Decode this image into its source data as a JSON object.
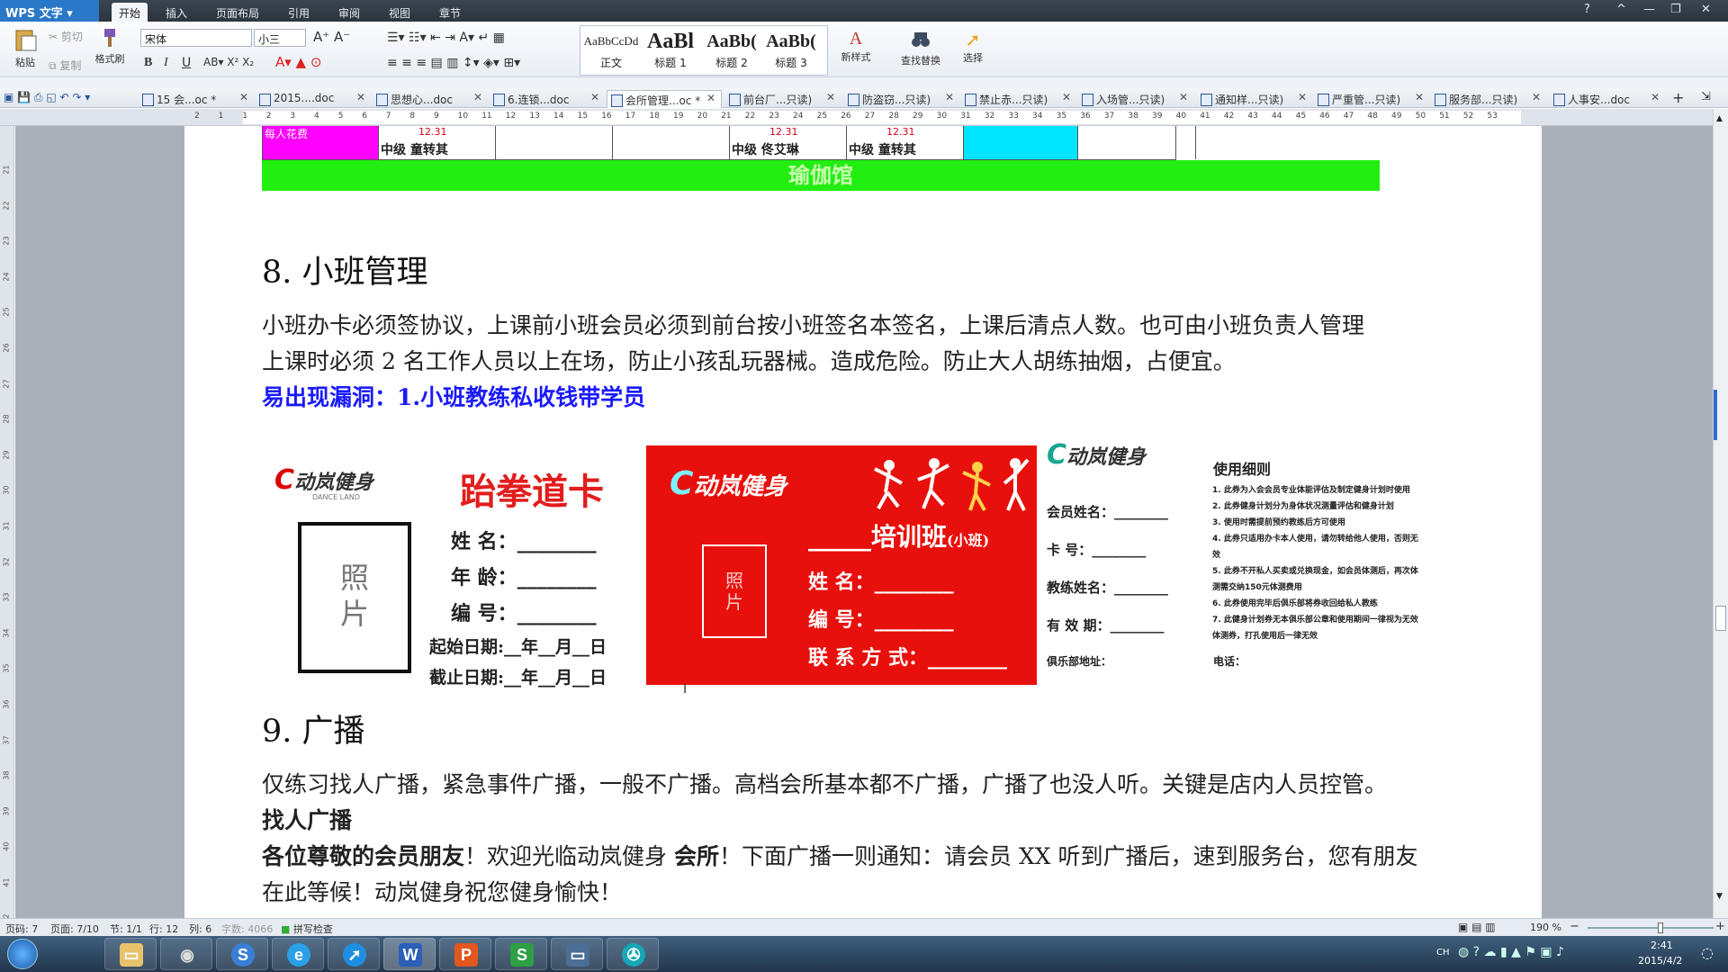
{
  "app": {
    "name": "WPS 文字"
  },
  "menu": {
    "tabs": [
      "开始",
      "插入",
      "页面布局",
      "引用",
      "审阅",
      "视图",
      "章节"
    ],
    "active": "开始"
  },
  "window_controls": [
    "?",
    "^",
    "—",
    "❐",
    "✕"
  ],
  "ribbon": {
    "paste": "粘贴",
    "cut": "剪切",
    "copy": "复制",
    "format_painter": "格式刷",
    "font_name": "宋体",
    "font_size": "小三",
    "styles": [
      {
        "preview": "AaBbCcDd",
        "label": "正文"
      },
      {
        "preview": "AaBl",
        "label": "标题 1"
      },
      {
        "preview": "AaBb(",
        "label": "标题 2"
      },
      {
        "preview": "AaBb(",
        "label": "标题 3"
      }
    ],
    "new_style": "新样式",
    "find_replace": "查找替换",
    "select": "选择"
  },
  "doc_tabs": [
    {
      "label": "15 会...oc *"
    },
    {
      "label": "2015....doc"
    },
    {
      "label": "思想心...doc"
    },
    {
      "label": "6.连锁...doc"
    },
    {
      "label": "会所管理...oc *",
      "active": true
    },
    {
      "label": "前台厂...只读)"
    },
    {
      "label": "防盗窃...只读)"
    },
    {
      "label": "禁止赤...只读)"
    },
    {
      "label": "入场管...只读)"
    },
    {
      "label": "通知样...只读)"
    },
    {
      "label": "严重管...只读)"
    },
    {
      "label": "服务部...只读)"
    },
    {
      "label": "人事安...doc"
    }
  ],
  "ruler": {
    "h_numbers": [
      "2",
      "1",
      "1",
      "2",
      "3",
      "4",
      "5",
      "6",
      "7",
      "8",
      "9",
      "10",
      "11",
      "12",
      "13",
      "14",
      "15",
      "16",
      "17",
      "18",
      "19",
      "20",
      "21",
      "22",
      "23",
      "24",
      "25",
      "26",
      "27",
      "28",
      "29",
      "30",
      "31",
      "32",
      "33",
      "34",
      "35",
      "36",
      "37",
      "38",
      "39",
      "40",
      "41",
      "42",
      "43",
      "44",
      "45",
      "46",
      "47",
      "48",
      "49",
      "50",
      "51",
      "52",
      "53"
    ],
    "v_numbers": [
      "21",
      "22",
      "23",
      "24",
      "25",
      "26",
      "27",
      "28",
      "29",
      "30",
      "31",
      "32",
      "33",
      "34",
      "35",
      "36",
      "37",
      "38",
      "39",
      "40",
      "41",
      "42"
    ]
  },
  "schedule": {
    "left_label": "每人花费",
    "cells": [
      {
        "time": "12.31",
        "text": "中级  童转其"
      },
      {
        "time": "12.31",
        "text": "中级  佟艾琳"
      },
      {
        "time": "12.31",
        "text": "中级  童转其"
      }
    ],
    "yoga": "瑜伽馆"
  },
  "section8": {
    "heading": "8.  小班管理",
    "p1": "小班办卡必须签协议，上课前小班会员必须到前台按小班签名本签名，上课后清点人数。也可由小班负责人管理",
    "p2": "上课时必须 2 名工作人员以上在场，防止小孩乱玩器械。造成危险。防止大人胡练抽烟，占便宜。",
    "loophole": "易出现漏洞：1.小班教练私收钱带学员"
  },
  "card1": {
    "brand": "动岚健身",
    "brand_sub": "DANCE LAND",
    "title": "跆拳道卡",
    "photo": "照\n片",
    "fields": [
      "姓 名：________",
      "年 龄：________",
      "编 号：________"
    ],
    "start": "起始日期:__年__月__日",
    "end": "截止日期:__年__月__日"
  },
  "card2": {
    "brand": "动岚健身",
    "title": "_____培训班",
    "title_small": "(小班)",
    "photo": "照\n片",
    "fields": [
      "姓 名：________",
      "编 号：________",
      "联 系 方 式：________"
    ]
  },
  "card3": {
    "brand": "动岚健身",
    "fields": [
      "会员姓名：________",
      "卡    号：________",
      "教练姓名：________",
      "有 效 期：________"
    ],
    "club_address": "俱乐部地址：",
    "rules_title": "使用细则",
    "rules": [
      "1. 此券为入会会员专业体能评估及制定健身计划时使用",
      "2. 此券健身计划分为身体状况测量评估和健身计划",
      "3. 使用时需提前预约教练后方可使用",
      "4. 此券只适用办卡本人使用，请勿转给他人使用，否则无效",
      "5. 此券不开私人买卖或兑换现金，如会员体测后，再次体测需交纳150元体测费用",
      "6. 此券使用完毕后俱乐部将券收回给私人教练",
      "7. 此健身计划券无本俱乐部公章和使用期间一律视为无效体测券，打孔使用后一律无效"
    ],
    "phone": "电话："
  },
  "section9": {
    "heading": "9.  广播",
    "p1": "仅练习找人广播，紧急事件广播，一般不广播。高档会所基本都不广播，广播了也没人听。关键是店内人员控管。",
    "p2": "找人广播",
    "p3_bold1": "各位尊敬的会员朋友",
    "p3_mid": "！欢迎光临动岚健身",
    "p3_bold2": "会所",
    "p3_rest": "！下面广播一则通知：请会员 XX 听到广播后，速到服务台，您有朋友",
    "p4": "在此等候！动岚健身祝您健身愉快！"
  },
  "status": {
    "page_code": "页码: 7",
    "page": "页面: 7/10",
    "section": "节: 1/1",
    "row": "行: 12",
    "col": "列: 6",
    "wordcount": "字数: 4066",
    "spell": "拼写检查",
    "zoom": "190 %"
  },
  "taskbar": {
    "clock_time": "2:41",
    "clock_date": "2015/4/2",
    "ime": "CH"
  },
  "colors": {
    "magenta": "#ff00ff",
    "cyan": "#00e5ff",
    "green": "#22ee11",
    "blue_text": "#1a1aff",
    "card_red": "#e8100c"
  }
}
